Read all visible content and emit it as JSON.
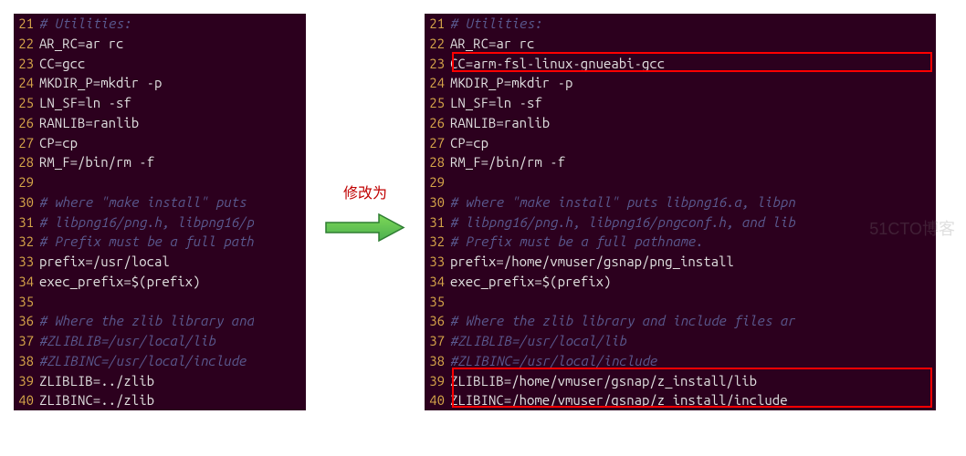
{
  "label": "修改为",
  "watermark": "51CTO博客",
  "left": {
    "lines": [
      {
        "n": "21",
        "t": "comment",
        "c": "# Utilities:"
      },
      {
        "n": "22",
        "t": "code",
        "c": "AR_RC=ar rc"
      },
      {
        "n": "23",
        "t": "code",
        "c": "CC=gcc"
      },
      {
        "n": "24",
        "t": "code",
        "c": "MKDIR_P=mkdir -p"
      },
      {
        "n": "25",
        "t": "code",
        "c": "LN_SF=ln -sf"
      },
      {
        "n": "26",
        "t": "code",
        "c": "RANLIB=ranlib"
      },
      {
        "n": "27",
        "t": "code",
        "c": "CP=cp"
      },
      {
        "n": "28",
        "t": "code",
        "c": "RM_F=/bin/rm -f"
      },
      {
        "n": "29",
        "t": "code",
        "c": ""
      },
      {
        "n": "30",
        "t": "comment",
        "c": "# where \"make install\" puts "
      },
      {
        "n": "31",
        "t": "comment",
        "c": "# libpng16/png.h, libpng16/p"
      },
      {
        "n": "32",
        "t": "comment",
        "c": "# Prefix must be a full path"
      },
      {
        "n": "33",
        "t": "code",
        "c": "prefix=/usr/local"
      },
      {
        "n": "34",
        "t": "code",
        "c": "exec_prefix=$(prefix)"
      },
      {
        "n": "35",
        "t": "code",
        "c": ""
      },
      {
        "n": "36",
        "t": "comment",
        "c": "# Where the zlib library and"
      },
      {
        "n": "37",
        "t": "comment",
        "c": "#ZLIBLIB=/usr/local/lib"
      },
      {
        "n": "38",
        "t": "comment",
        "c": "#ZLIBINC=/usr/local/include"
      },
      {
        "n": "39",
        "t": "code",
        "c": "ZLIBLIB=../zlib"
      },
      {
        "n": "40",
        "t": "code",
        "c": "ZLIBINC=../zlib"
      }
    ]
  },
  "right": {
    "lines": [
      {
        "n": "21",
        "t": "comment",
        "c": "# Utilities:"
      },
      {
        "n": "22",
        "t": "code",
        "c": "AR_RC=ar rc"
      },
      {
        "n": "23",
        "t": "code",
        "c": "CC=arm-fsl-linux-gnueabi-gcc"
      },
      {
        "n": "24",
        "t": "code",
        "c": "MKDIR_P=mkdir -p"
      },
      {
        "n": "25",
        "t": "code",
        "c": "LN_SF=ln -sf"
      },
      {
        "n": "26",
        "t": "code",
        "c": "RANLIB=ranlib"
      },
      {
        "n": "27",
        "t": "code",
        "c": "CP=cp"
      },
      {
        "n": "28",
        "t": "code",
        "c": "RM_F=/bin/rm -f"
      },
      {
        "n": "29",
        "t": "code",
        "c": ""
      },
      {
        "n": "30",
        "t": "comment",
        "c": "# where \"make install\" puts libpng16.a, libpn"
      },
      {
        "n": "31",
        "t": "comment",
        "c": "# libpng16/png.h, libpng16/pngconf.h, and lib"
      },
      {
        "n": "32",
        "t": "comment",
        "c": "# Prefix must be a full pathname."
      },
      {
        "n": "33",
        "t": "code",
        "c": "prefix=/home/vmuser/gsnap/png_install"
      },
      {
        "n": "34",
        "t": "code",
        "c": "exec_prefix=$(prefix)"
      },
      {
        "n": "35",
        "t": "code",
        "c": ""
      },
      {
        "n": "36",
        "t": "comment",
        "c": "# Where the zlib library and include files ar"
      },
      {
        "n": "37",
        "t": "comment",
        "c": "#ZLIBLIB=/usr/local/lib"
      },
      {
        "n": "38",
        "t": "comment",
        "c": "#ZLIBINC=/usr/local/include"
      },
      {
        "n": "39",
        "t": "code",
        "c": "ZLIBLIB=/home/vmuser/gsnap/z_install/lib"
      },
      {
        "n": "40",
        "t": "code",
        "c": "ZLIBINC=/home/vmuser/gsnap/z_install/include"
      }
    ]
  }
}
